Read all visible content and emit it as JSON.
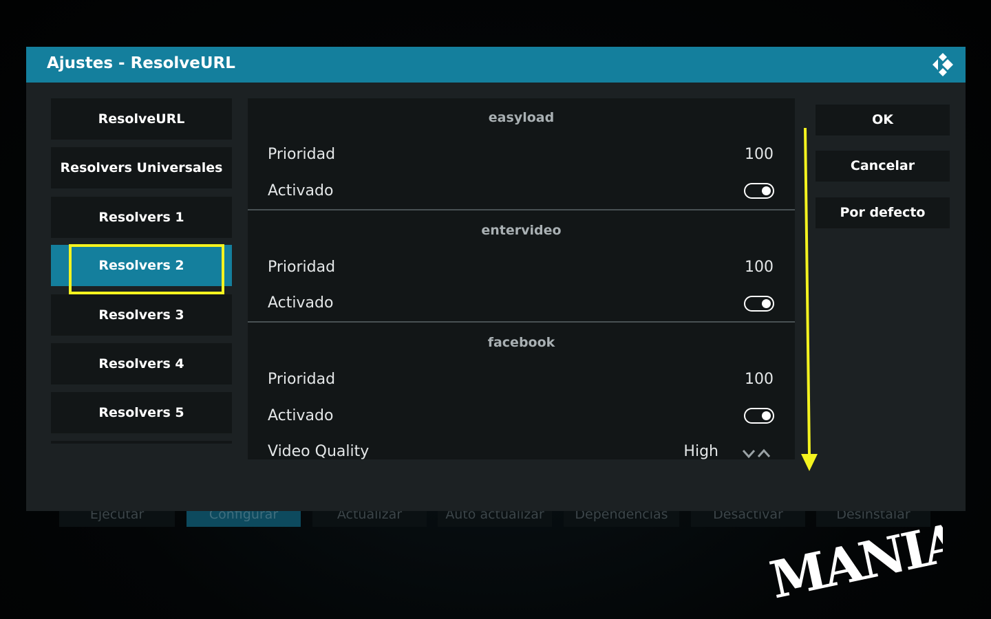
{
  "background": {
    "actions": [
      {
        "label": "Ejecutar",
        "active": false
      },
      {
        "label": "Configurar",
        "active": true
      },
      {
        "label": "Actualizar",
        "active": false
      },
      {
        "label": "Auto actualizar",
        "active": false
      },
      {
        "label": "Dependencias",
        "active": false
      },
      {
        "label": "Desactivar",
        "active": false
      },
      {
        "label": "Desinstalar",
        "active": false
      }
    ]
  },
  "dialog": {
    "title": "Ajustes - ResolveURL",
    "header_color": "#147f9d",
    "logo_icon": "kodi-logo-icon"
  },
  "categories": [
    {
      "label": "ResolveURL",
      "selected": false
    },
    {
      "label": "Resolvers Universales",
      "selected": false
    },
    {
      "label": "Resolvers 1",
      "selected": false
    },
    {
      "label": "Resolvers 2",
      "selected": true
    },
    {
      "label": "Resolvers 3",
      "selected": false
    },
    {
      "label": "Resolvers 4",
      "selected": false
    },
    {
      "label": "Resolvers 5",
      "selected": false
    }
  ],
  "settings": {
    "sections": [
      {
        "name": "easyload",
        "priority_label": "Prioridad",
        "priority_value": "100",
        "enabled_label": "Activado",
        "enabled": true
      },
      {
        "name": "entervideo",
        "priority_label": "Prioridad",
        "priority_value": "100",
        "enabled_label": "Activado",
        "enabled": true
      },
      {
        "name": "facebook",
        "priority_label": "Prioridad",
        "priority_value": "100",
        "enabled_label": "Activado",
        "enabled": true,
        "quality_label": "Video Quality",
        "quality_value": "High"
      }
    ]
  },
  "buttons": {
    "ok": "OK",
    "cancel": "Cancelar",
    "default": "Por defecto"
  },
  "annotations": {
    "highlight_color": "#f4f31f",
    "arrow_icon": "scroll-down-arrow-icon"
  },
  "watermark": {
    "text": "MANIAC"
  }
}
